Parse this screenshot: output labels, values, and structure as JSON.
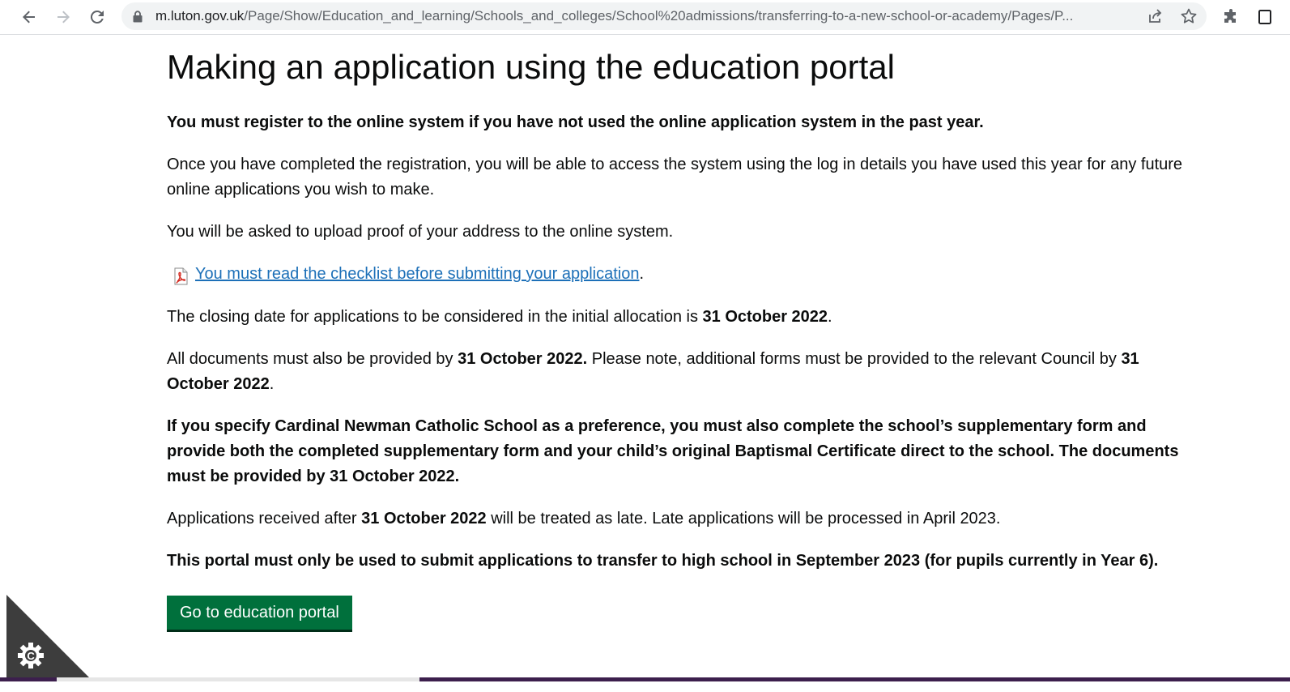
{
  "browser": {
    "url_host": "m.luton.gov.uk",
    "url_path": "/Page/Show/Education_and_learning/Schools_and_colleges/School%20admissions/transferring-to-a-new-school-or-academy/Pages/P...",
    "icons": [
      "back-icon",
      "forward-icon",
      "reload-icon",
      "lock-icon",
      "share-icon",
      "star-icon",
      "extensions-icon",
      "window-icon"
    ]
  },
  "page": {
    "title": "Making an application using the education portal",
    "p_register": "You must register to the online system if you have not used the online application system in the past year.",
    "p_once": "Once you have completed the registration, you will be able to access the system using the log in details you have used this year for any future online applications you wish to make.",
    "p_upload": "You will be asked to upload proof of your address to the online system.",
    "checklist_link": "You must read the checklist before submitting your application",
    "checklist_after": ".",
    "closing_pre": "The closing date for applications to be considered in the initial allocation is ",
    "closing_date": "31 October 2022",
    "closing_post": ".",
    "docs_pre": "All documents must also be provided by ",
    "docs_date1": "31 October 2022.",
    "docs_mid": " Please note, additional forms must be provided to the relevant Council by ",
    "docs_date2": "31 October 2022",
    "docs_post": ".",
    "p_cardinal": "If you specify Cardinal Newman Catholic School as a preference, you must also complete the school’s supplementary form and provide both the completed supplementary form and your child’s original Baptismal Certificate direct to the school. The documents must be provided by 31 October 2022.",
    "late_pre": "Applications received after ",
    "late_date": "31 October 2022",
    "late_post": " will be treated as late. Late applications will be processed in April 2023.",
    "p_portal": "This portal must only be used to submit applications to transfer to high school in September 2023 (for pupils currently in Year 6).",
    "button_label": "Go to education portal"
  },
  "cookie_widget": {
    "icon": "gear-icon",
    "letter": "C"
  },
  "colors": {
    "link": "#1d70b8",
    "button": "#00703c",
    "button_shadow": "#002d18",
    "cookie_corner": "#3d3d3d",
    "bottom_strip": "#3c1f4d"
  }
}
